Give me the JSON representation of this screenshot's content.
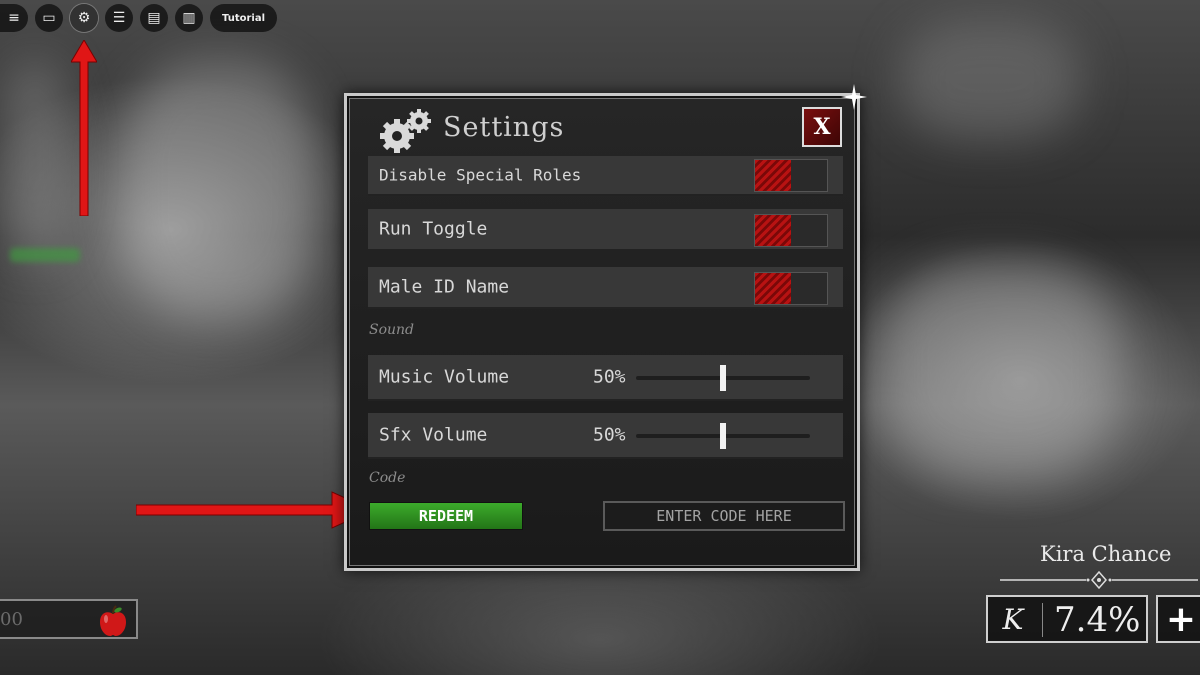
{
  "topbar": {
    "buttons": [
      {
        "icon": "menu-icon",
        "glyph": "≡"
      },
      {
        "icon": "chat-icon",
        "glyph": "▭"
      },
      {
        "icon": "gear-icon",
        "glyph": "⚙"
      },
      {
        "icon": "list-icon",
        "glyph": "☰"
      },
      {
        "icon": "message-icon",
        "glyph": "▤"
      },
      {
        "icon": "gift-icon",
        "glyph": "▥"
      }
    ],
    "tutorial_label": "Tutorial"
  },
  "settings": {
    "title": "Settings",
    "close_label": "X",
    "toggles": [
      {
        "label": "Disable Special Roles",
        "on": true
      },
      {
        "label": "Run Toggle",
        "on": true
      },
      {
        "label": "Male ID Name",
        "on": true
      }
    ],
    "sound_section": "Sound",
    "volumes": [
      {
        "label": "Music Volume",
        "value_text": "50%",
        "level": 0.5
      },
      {
        "label": "Sfx Volume",
        "value_text": "50%",
        "level": 0.5
      }
    ],
    "code_section": "Code",
    "redeem_label": "REDEEM",
    "code_placeholder": "ENTER CODE HERE"
  },
  "hud": {
    "coins_value": "00",
    "kira_title": "Kira Chance",
    "kira_symbol": "K",
    "kira_value": "7.4%",
    "plus_label": "+"
  },
  "colors": {
    "annotation_arrow": "#e01616",
    "toggle_on": "#b81212",
    "redeem": "#2f8f22"
  }
}
